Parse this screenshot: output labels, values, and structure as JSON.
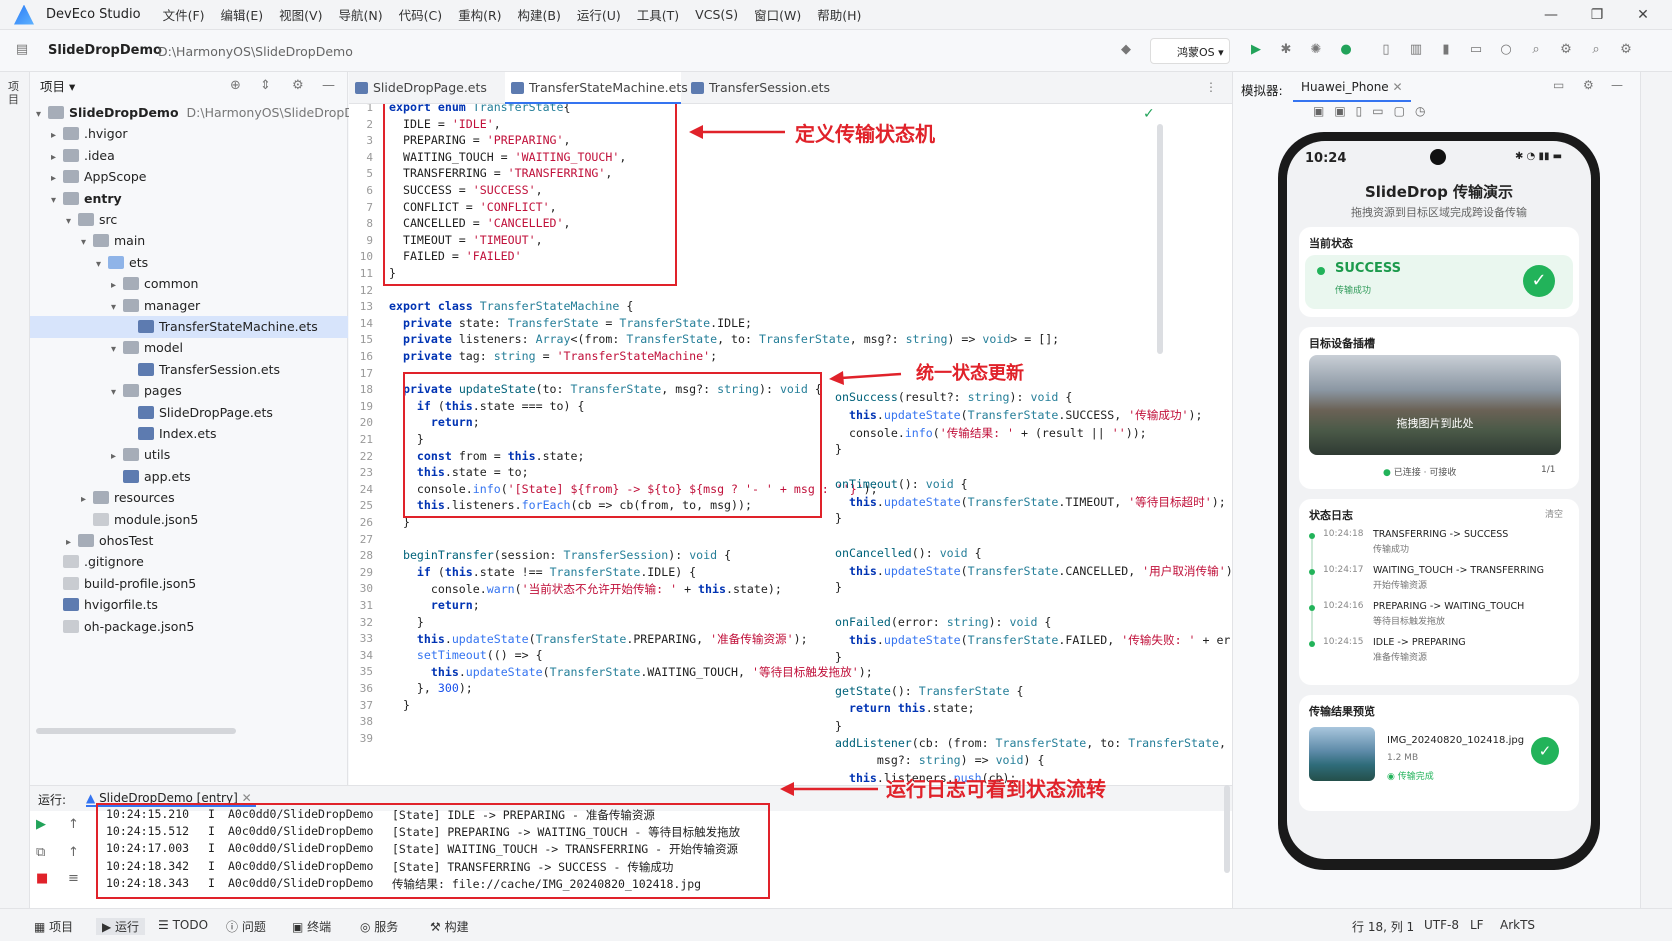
{
  "titlebar": {
    "app": "DevEco Studio",
    "menus": [
      "文件(F)",
      "编辑(E)",
      "视图(V)",
      "导航(N)",
      "代码(C)",
      "重构(R)",
      "构建(B)",
      "运行(U)",
      "工具(T)",
      "VCS(S)",
      "窗口(W)",
      "帮助(H)"
    ]
  },
  "toolbar": {
    "project": "SlideDropDemo",
    "path": "D:\\HarmonyOS\\SlideDropDemo",
    "device": "鸿蒙OS"
  },
  "left_strip": {
    "label": "项目"
  },
  "project": {
    "title": "项目",
    "tree": [
      {
        "label": "SlideDropDemo",
        "suffix": "D:\\HarmonyOS\\SlideDropDemo",
        "indent": 0,
        "arrow": "▾",
        "icon": "folder",
        "bold": true
      },
      {
        "label": ".hvigor",
        "indent": 1,
        "arrow": "▸",
        "icon": "folder"
      },
      {
        "label": ".idea",
        "indent": 1,
        "arrow": "▸",
        "icon": "folder"
      },
      {
        "label": "AppScope",
        "indent": 1,
        "arrow": "▸",
        "icon": "folder"
      },
      {
        "label": "entry",
        "indent": 1,
        "arrow": "▾",
        "icon": "folder",
        "bold": true
      },
      {
        "label": "src",
        "indent": 2,
        "arrow": "▾",
        "icon": "folder"
      },
      {
        "label": "main",
        "indent": 3,
        "arrow": "▾",
        "icon": "folder"
      },
      {
        "label": "ets",
        "indent": 4,
        "arrow": "▾",
        "icon": "folder blue"
      },
      {
        "label": "common",
        "indent": 5,
        "arrow": "▸",
        "icon": "folder"
      },
      {
        "label": "manager",
        "indent": 5,
        "arrow": "▾",
        "icon": "folder"
      },
      {
        "label": "TransferStateMachine.ets",
        "indent": 6,
        "arrow": "",
        "icon": "file-ets",
        "selected": true
      },
      {
        "label": "model",
        "indent": 5,
        "arrow": "▾",
        "icon": "folder"
      },
      {
        "label": "TransferSession.ets",
        "indent": 6,
        "arrow": "",
        "icon": "file-ets"
      },
      {
        "label": "pages",
        "indent": 5,
        "arrow": "▾",
        "icon": "folder"
      },
      {
        "label": "SlideDropPage.ets",
        "indent": 6,
        "arrow": "",
        "icon": "file-ets"
      },
      {
        "label": "Index.ets",
        "indent": 6,
        "arrow": "",
        "icon": "file-ets"
      },
      {
        "label": "utils",
        "indent": 5,
        "arrow": "▸",
        "icon": "folder"
      },
      {
        "label": "app.ets",
        "indent": 5,
        "arrow": "",
        "icon": "file-ets"
      },
      {
        "label": "resources",
        "indent": 3,
        "arrow": "▸",
        "icon": "folder"
      },
      {
        "label": "module.json5",
        "indent": 3,
        "arrow": "",
        "icon": "file-json"
      },
      {
        "label": "ohosTest",
        "indent": 2,
        "arrow": "▸",
        "icon": "folder"
      },
      {
        "label": ".gitignore",
        "indent": 1,
        "arrow": "",
        "icon": "file-json"
      },
      {
        "label": "build-profile.json5",
        "indent": 1,
        "arrow": "",
        "icon": "file-json"
      },
      {
        "label": "hvigorfile.ts",
        "indent": 1,
        "arrow": "",
        "icon": "file-ets"
      },
      {
        "label": "oh-package.json5",
        "indent": 1,
        "arrow": "",
        "icon": "file-json"
      }
    ]
  },
  "tabs": [
    "SlideDropPage.ets",
    "TransferStateMachine.ets",
    "TransferSession.ets"
  ],
  "code_left": [
    [
      [
        "kw",
        "export enum "
      ],
      [
        "ty",
        "TransferState"
      ],
      [
        "",
        "{"
      ]
    ],
    [
      [
        "",
        "  IDLE = "
      ],
      [
        "st",
        "'IDLE'"
      ],
      [
        "",
        ","
      ]
    ],
    [
      [
        "",
        "  PREPARING = "
      ],
      [
        "st",
        "'PREPARING'"
      ],
      [
        "",
        ","
      ]
    ],
    [
      [
        "",
        "  WAITING_TOUCH = "
      ],
      [
        "st",
        "'WAITING_TOUCH'"
      ],
      [
        "",
        ","
      ]
    ],
    [
      [
        "",
        "  TRANSFERRING = "
      ],
      [
        "st",
        "'TRANSFERRING'"
      ],
      [
        "",
        ","
      ]
    ],
    [
      [
        "",
        "  SUCCESS = "
      ],
      [
        "st",
        "'SUCCESS'"
      ],
      [
        "",
        ","
      ]
    ],
    [
      [
        "",
        "  CONFLICT = "
      ],
      [
        "st",
        "'CONFLICT'"
      ],
      [
        "",
        ","
      ]
    ],
    [
      [
        "",
        "  CANCELLED = "
      ],
      [
        "st",
        "'CANCELLED'"
      ],
      [
        "",
        ","
      ]
    ],
    [
      [
        "",
        "  TIMEOUT = "
      ],
      [
        "st",
        "'TIMEOUT'"
      ],
      [
        "",
        ","
      ]
    ],
    [
      [
        "",
        "  FAILED = "
      ],
      [
        "st",
        "'FAILED'"
      ]
    ],
    [
      [
        "",
        "}"
      ]
    ],
    [
      [
        "",
        ""
      ]
    ],
    [
      [
        "kw",
        "export class "
      ],
      [
        "ty",
        "TransferStateMachine"
      ],
      [
        "",
        " {"
      ]
    ],
    [
      [
        "kw",
        "  private "
      ],
      [
        "",
        "state: "
      ],
      [
        "ty",
        "TransferState"
      ],
      [
        "",
        " = "
      ],
      [
        "ty",
        "TransferState"
      ],
      [
        "",
        ".IDLE;"
      ]
    ],
    [
      [
        "kw",
        "  private "
      ],
      [
        "",
        "listeners: "
      ],
      [
        "ty",
        "Array"
      ],
      [
        "",
        "<(from: "
      ],
      [
        "ty",
        "TransferState"
      ],
      [
        "",
        ", to: "
      ],
      [
        "ty",
        "TransferState"
      ],
      [
        "",
        ", msg?: "
      ],
      [
        "ty",
        "string"
      ],
      [
        "",
        ") => "
      ],
      [
        "ty",
        "void"
      ],
      [
        "",
        "> = [];"
      ]
    ],
    [
      [
        "kw",
        "  private "
      ],
      [
        "",
        "tag: "
      ],
      [
        "ty",
        "string"
      ],
      [
        "",
        " = "
      ],
      [
        "st",
        "'TransferStateMachine'"
      ],
      [
        "",
        ";"
      ]
    ],
    [
      [
        "",
        ""
      ]
    ],
    [
      [
        "kw",
        "  private "
      ],
      [
        "fn",
        "updateState"
      ],
      [
        "",
        "(to: "
      ],
      [
        "ty",
        "TransferState"
      ],
      [
        "",
        ", msg?: "
      ],
      [
        "ty",
        "string"
      ],
      [
        "",
        "): "
      ],
      [
        "ty",
        "void"
      ],
      [
        "",
        " {"
      ]
    ],
    [
      [
        "kw",
        "    if "
      ],
      [
        "",
        "("
      ],
      [
        "kw",
        "this"
      ],
      [
        "",
        ".state === to) {"
      ]
    ],
    [
      [
        "kw",
        "      return"
      ],
      [
        "",
        ";"
      ]
    ],
    [
      [
        "",
        "    }"
      ]
    ],
    [
      [
        "kw",
        "    const "
      ],
      [
        "",
        "from = "
      ],
      [
        "kw",
        "this"
      ],
      [
        "",
        ".state;"
      ]
    ],
    [
      [
        "kw",
        "    this"
      ],
      [
        "",
        ".state = to;"
      ]
    ],
    [
      [
        "",
        "    console."
      ],
      [
        "mt",
        "info"
      ],
      [
        "",
        "("
      ],
      [
        "st",
        "'[State] ${from} -> ${to} ${msg ? '- ' + msg : ''}'"
      ],
      [
        "",
        ");"
      ]
    ],
    [
      [
        "kw",
        "    this"
      ],
      [
        "",
        ".listeners."
      ],
      [
        "mt",
        "forEach"
      ],
      [
        "",
        "(cb => cb(from, to, msg));"
      ]
    ],
    [
      [
        "",
        "  }"
      ]
    ],
    [
      [
        "",
        ""
      ]
    ],
    [
      [
        "",
        "  "
      ],
      [
        "fn",
        "beginTransfer"
      ],
      [
        "",
        "(session: "
      ],
      [
        "ty",
        "TransferSession"
      ],
      [
        "",
        "): "
      ],
      [
        "ty",
        "void"
      ],
      [
        "",
        " {"
      ]
    ],
    [
      [
        "kw",
        "    if "
      ],
      [
        "",
        "("
      ],
      [
        "kw",
        "this"
      ],
      [
        "",
        ".state !== "
      ],
      [
        "ty",
        "TransferState"
      ],
      [
        "",
        ".IDLE) {"
      ]
    ],
    [
      [
        "",
        "      console."
      ],
      [
        "mt",
        "warn"
      ],
      [
        "",
        "("
      ],
      [
        "st",
        "'当前状态不允许开始传输: '"
      ],
      [
        "",
        " + "
      ],
      [
        "kw",
        "this"
      ],
      [
        "",
        ".state);"
      ]
    ],
    [
      [
        "kw",
        "      return"
      ],
      [
        "",
        ";"
      ]
    ],
    [
      [
        "",
        "    }"
      ]
    ],
    [
      [
        "kw",
        "    this"
      ],
      [
        "",
        "."
      ],
      [
        "mt",
        "updateState"
      ],
      [
        "",
        "("
      ],
      [
        "ty",
        "TransferState"
      ],
      [
        "",
        ".PREPARING, "
      ],
      [
        "st",
        "'准备传输资源'"
      ],
      [
        "",
        ");"
      ]
    ],
    [
      [
        "",
        "    "
      ],
      [
        "mt",
        "setTimeout"
      ],
      [
        "",
        "(() => {"
      ]
    ],
    [
      [
        "kw",
        "      this"
      ],
      [
        "",
        "."
      ],
      [
        "mt",
        "updateState"
      ],
      [
        "",
        "("
      ],
      [
        "ty",
        "TransferState"
      ],
      [
        "",
        ".WAITING_TOUCH, "
      ],
      [
        "st",
        "'等待目标触发拖放'"
      ],
      [
        "",
        ");"
      ]
    ],
    [
      [
        "",
        "    }, "
      ],
      [
        "nm",
        "300"
      ],
      [
        "",
        ");"
      ]
    ],
    [
      [
        "",
        "  }"
      ]
    ],
    [
      [
        "",
        ""
      ]
    ],
    [
      [
        "",
        ""
      ]
    ]
  ],
  "code_right": [
    [
      [
        "fn",
        "onSuccess"
      ],
      [
        "",
        "(result?: "
      ],
      [
        "ty",
        "string"
      ],
      [
        "",
        "): "
      ],
      [
        "ty",
        "void"
      ],
      [
        "",
        " {"
      ]
    ],
    [
      [
        "kw",
        "  this"
      ],
      [
        "",
        "."
      ],
      [
        "mt",
        "updateState"
      ],
      [
        "",
        "("
      ],
      [
        "ty",
        "TransferState"
      ],
      [
        "",
        ".SUCCESS, "
      ],
      [
        "st",
        "'传输成功'"
      ],
      [
        "",
        ");"
      ]
    ],
    [
      [
        "",
        "  console."
      ],
      [
        "mt",
        "info"
      ],
      [
        "",
        "("
      ],
      [
        "st",
        "'传输结果: '"
      ],
      [
        "",
        " + (result || "
      ],
      [
        "st",
        "''"
      ],
      [
        "",
        "));"
      ]
    ],
    [
      [
        "",
        "}"
      ]
    ],
    [
      [
        "",
        ""
      ]
    ],
    [
      [
        "fn",
        "onTimeout"
      ],
      [
        "",
        "(): "
      ],
      [
        "ty",
        "void"
      ],
      [
        "",
        " {"
      ]
    ],
    [
      [
        "kw",
        "  this"
      ],
      [
        "",
        "."
      ],
      [
        "mt",
        "updateState"
      ],
      [
        "",
        "("
      ],
      [
        "ty",
        "TransferState"
      ],
      [
        "",
        ".TIMEOUT, "
      ],
      [
        "st",
        "'等待目标超时'"
      ],
      [
        "",
        ");"
      ]
    ],
    [
      [
        "",
        "}"
      ]
    ],
    [
      [
        "",
        ""
      ]
    ],
    [
      [
        "fn",
        "onCancelled"
      ],
      [
        "",
        "(): "
      ],
      [
        "ty",
        "void"
      ],
      [
        "",
        " {"
      ]
    ],
    [
      [
        "kw",
        "  this"
      ],
      [
        "",
        "."
      ],
      [
        "mt",
        "updateState"
      ],
      [
        "",
        "("
      ],
      [
        "ty",
        "TransferState"
      ],
      [
        "",
        ".CANCELLED, "
      ],
      [
        "st",
        "'用户取消传输'"
      ],
      [
        "",
        ");"
      ]
    ],
    [
      [
        "",
        "}"
      ]
    ],
    [
      [
        "",
        ""
      ]
    ],
    [
      [
        "fn",
        "onFailed"
      ],
      [
        "",
        "(error: "
      ],
      [
        "ty",
        "string"
      ],
      [
        "",
        "): "
      ],
      [
        "ty",
        "void"
      ],
      [
        "",
        " {"
      ]
    ],
    [
      [
        "kw",
        "  this"
      ],
      [
        "",
        "."
      ],
      [
        "mt",
        "updateState"
      ],
      [
        "",
        "("
      ],
      [
        "ty",
        "TransferState"
      ],
      [
        "",
        ".FAILED, "
      ],
      [
        "st",
        "'传输失败: '"
      ],
      [
        "",
        " + error);"
      ]
    ],
    [
      [
        "",
        "}"
      ]
    ],
    [
      [
        "",
        ""
      ]
    ],
    [
      [
        "fn",
        "getState"
      ],
      [
        "",
        "(): "
      ],
      [
        "ty",
        "TransferState"
      ],
      [
        "",
        " {"
      ]
    ],
    [
      [
        "kw",
        "  return this"
      ],
      [
        "",
        ".state;"
      ]
    ],
    [
      [
        "",
        "}"
      ]
    ],
    [
      [
        "fn",
        "addListener"
      ],
      [
        "",
        "(cb: (from: "
      ],
      [
        "ty",
        "TransferState"
      ],
      [
        "",
        ", to: "
      ],
      [
        "ty",
        "TransferState"
      ],
      [
        "",
        ","
      ]
    ],
    [
      [
        "",
        "      msg?: "
      ],
      [
        "ty",
        "string"
      ],
      [
        "",
        ") => "
      ],
      [
        "ty",
        "void"
      ],
      [
        "",
        ") {"
      ]
    ],
    [
      [
        "kw",
        "  this"
      ],
      [
        "",
        ".listeners."
      ],
      [
        "mt",
        "push"
      ],
      [
        "",
        "(cb);"
      ]
    ],
    [
      [
        "",
        "}"
      ]
    ]
  ],
  "annotations": {
    "a1": "定义传输状态机",
    "a2": "统一状态更新",
    "a3": "运行日志可看到状态流转"
  },
  "emulator": {
    "label": "模拟器:",
    "device": "Huawei_Phone"
  },
  "phone": {
    "time": "10:24",
    "title": "SlideDrop 传输演示",
    "subtitle": "拖拽资源到目标区域完成跨设备传输",
    "state_section": "当前状态",
    "state": "SUCCESS",
    "state_sub": "传输成功",
    "slot_section": "目标设备插槽",
    "slot_text": "拖拽图片到此处",
    "slot_status": "已连接 · 可接收",
    "slot_count": "1/1",
    "log_section": "状态日志",
    "log_clear": "清空",
    "logs": [
      {
        "time": "10:24:18",
        "trans": "TRANSFERRING -> SUCCESS",
        "msg": "传输成功"
      },
      {
        "time": "10:24:17",
        "trans": "WAITING_TOUCH -> TRANSFERRING",
        "msg": "开始传输资源"
      },
      {
        "time": "10:24:16",
        "trans": "PREPARING -> WAITING_TOUCH",
        "msg": "等待目标触发拖放"
      },
      {
        "time": "10:24:15",
        "trans": "IDLE -> PREPARING",
        "msg": "准备传输资源"
      }
    ],
    "result_section": "传输结果预览",
    "file_name": "IMG_20240820_102418.jpg",
    "file_size": "1.2 MB",
    "file_status": "传输完成"
  },
  "run": {
    "label": "运行:",
    "config": "SlideDropDemo [entry]",
    "logs": [
      {
        "time": "10:24:15.210",
        "lvl": "I",
        "tag": "A0c0dd0/SlideDropDemo",
        "msg": "[State] IDLE -> PREPARING - 准备传输资源"
      },
      {
        "time": "10:24:15.512",
        "lvl": "I",
        "tag": "A0c0dd0/SlideDropDemo",
        "msg": "[State] PREPARING -> WAITING_TOUCH - 等待目标触发拖放"
      },
      {
        "time": "10:24:17.003",
        "lvl": "I",
        "tag": "A0c0dd0/SlideDropDemo",
        "msg": "[State] WAITING_TOUCH -> TRANSFERRING - 开始传输资源"
      },
      {
        "time": "10:24:18.342",
        "lvl": "I",
        "tag": "A0c0dd0/SlideDropDemo",
        "msg": "[State] TRANSFERRING -> SUCCESS - 传输成功"
      },
      {
        "time": "10:24:18.343",
        "lvl": "I",
        "tag": "A0c0dd0/SlideDropDemo",
        "msg": "传输结果: file://cache/IMG_20240820_102418.jpg"
      }
    ]
  },
  "statusbar": {
    "items": [
      "项目",
      "运行",
      "TODO",
      "问题",
      "终端",
      "服务",
      "构建"
    ],
    "pos": "行 18, 列 1",
    "enc": "UTF-8",
    "lf": "LF",
    "lang": "ArkTS"
  },
  "colors": {
    "accent": "#3574f0",
    "red": "#e0222a",
    "success": "#22b35a"
  }
}
